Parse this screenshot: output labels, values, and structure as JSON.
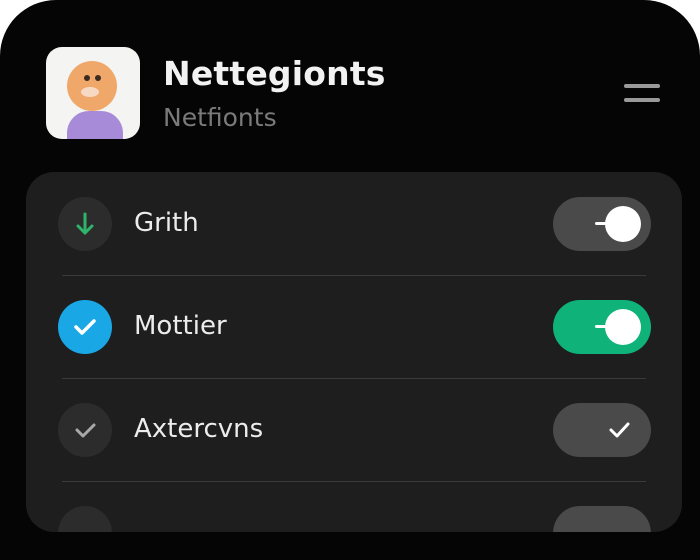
{
  "header": {
    "title": "Nettegionts",
    "subtitle": "Netfionts",
    "avatar_icon": "user-avatar-icon",
    "menu_icon": "hamburger-menu-icon"
  },
  "settings": {
    "items": [
      {
        "label": "Grith",
        "icon": "arrow-down-icon",
        "icon_color": "#2fb36a",
        "icon_bg": "#2c2c2c",
        "toggle_state": "on",
        "toggle_color": "#4a4a4a"
      },
      {
        "label": "Mottier",
        "icon": "checkmark-icon",
        "icon_color": "#ffffff",
        "icon_bg": "#1aa7e6",
        "toggle_state": "on",
        "toggle_color": "#0fb37a"
      },
      {
        "label": "Axtercvns",
        "icon": "checkmark-icon",
        "icon_color": "#a8a8a8",
        "icon_bg": "#2c2c2c",
        "toggle_state": "checked",
        "toggle_color": "#4a4a4a"
      }
    ]
  },
  "colors": {
    "background": "#050505",
    "card": "#1e1e1e",
    "accent_green": "#0fb37a",
    "accent_blue": "#1aa7e6"
  }
}
